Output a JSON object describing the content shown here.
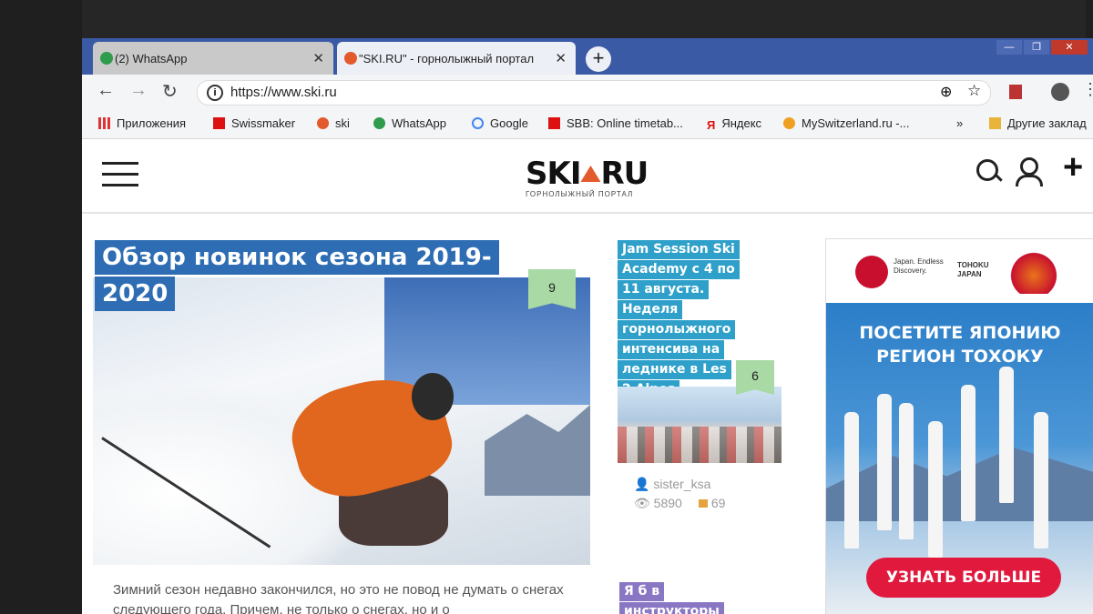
{
  "tabs": [
    {
      "title": "(2) WhatsApp",
      "close": "✕",
      "favicon_color": "#2e9b4d"
    },
    {
      "title": "\"SKI.RU\" - горнолыжный портал",
      "close": "✕",
      "favicon_color": "#e35a2d"
    }
  ],
  "new_tab_symbol": "+",
  "window_controls": {
    "minimize": "—",
    "maximize": "❐",
    "close": "✕"
  },
  "address_bar": {
    "url": "https://www.ski.ru"
  },
  "bookmarks": [
    {
      "label": "Приложения",
      "icon": "apps-grid-icon"
    },
    {
      "label": "Swissmaker",
      "icon": "swissmaker-icon"
    },
    {
      "label": "ski",
      "icon": "ski-icon"
    },
    {
      "label": "WhatsApp",
      "icon": "whatsapp-icon"
    },
    {
      "label": "Google",
      "icon": "google-icon"
    },
    {
      "label": "SBB: Online timetab...",
      "icon": "sbb-icon"
    },
    {
      "label": "Яндекс",
      "icon": "yandex-icon"
    },
    {
      "label": "MySwitzerland.ru -...",
      "icon": "myswitzerland-icon"
    },
    {
      "label": "»",
      "icon": "more-icon"
    },
    {
      "label": "Другие заклад",
      "icon": "folder-icon"
    }
  ],
  "site": {
    "logo": "SKI",
    "logo_suffix": "RU",
    "logo_subtitle": "ГОРНОЛЫЖНЫЙ ПОРТАЛ"
  },
  "feature": {
    "title_lines": [
      "Обзор новинок сезона 2019-",
      "2020"
    ],
    "comments": "9",
    "excerpt": "Зимний сезон недавно закончился, но это не повод не думать о снегах следующего года. Причем, не только о снегах, но и о"
  },
  "middle_article": {
    "title_lines": [
      "Jam Session Ski",
      "Academy с 4 по",
      "11 августа.",
      "Неделя",
      "горнолыжного",
      "интенсива на",
      "леднике в Les",
      "2 Alpes"
    ],
    "comments": "6",
    "author": "sister_ksa",
    "views": "5890",
    "comments_count": "69"
  },
  "middle_article_2": {
    "title_lines": [
      "Я б в",
      "инструкторы"
    ]
  },
  "ad": {
    "logo1_text": "Japan. Endless Discovery.",
    "logo2_text": "TOHOKU JAPAN",
    "headline_1": "ПОСЕТИТЕ ЯПОНИЮ",
    "headline_2": "РЕГИОН ТОХОКУ",
    "cta": "УЗНАТЬ БОЛЬШЕ"
  }
}
